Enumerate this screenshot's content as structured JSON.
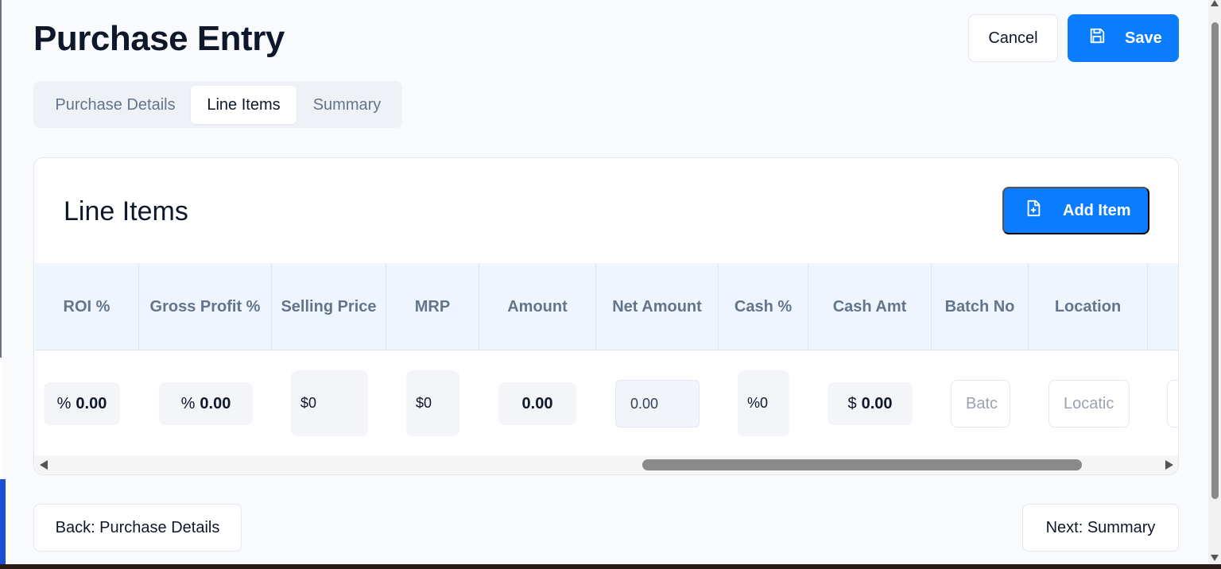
{
  "page": {
    "title": "Purchase Entry",
    "cancel_label": "Cancel",
    "save_label": "Save"
  },
  "tabs": [
    {
      "label": "Purchase Details",
      "active": false
    },
    {
      "label": "Line Items",
      "active": true
    },
    {
      "label": "Summary",
      "active": false
    }
  ],
  "line_items": {
    "title": "Line Items",
    "add_label": "Add Item",
    "columns": [
      "ROI %",
      "Gross Profit %",
      "Selling Price",
      "MRP",
      "Amount",
      "Net Amount",
      "Cash %",
      "Cash Amt",
      "Batch No",
      "Location"
    ],
    "row": {
      "roi_symbol": "%",
      "roi_value": "0.00",
      "gross_profit_symbol": "%",
      "gross_profit_value": "0.00",
      "selling_price_symbol": "$",
      "selling_price_value": "0",
      "mrp_symbol": "$",
      "mrp_value": "0",
      "amount_value": "0.00",
      "net_amount_value": "0.00",
      "cash_pct_symbol": "%",
      "cash_pct_value": "0",
      "cash_amt_symbol": "$",
      "cash_amt_value": "0.00",
      "batch_placeholder": "Batc",
      "location_placeholder": "Locatic"
    }
  },
  "footer": {
    "back_label": "Back: Purchase Details",
    "next_label": "Next: Summary"
  },
  "colors": {
    "primary": "#0a7cff",
    "header_bg": "#eef5ff",
    "page_bg": "#f8fafc"
  },
  "icons": {
    "save": "floppy-disk-icon",
    "add": "file-plus-icon"
  }
}
